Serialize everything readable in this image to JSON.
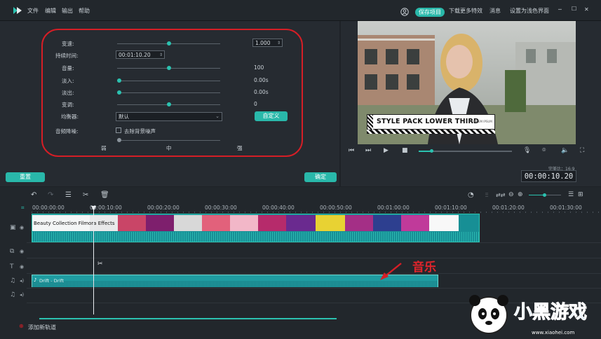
{
  "menu": {
    "file": "文件",
    "edit": "编辑",
    "export": "输出",
    "help": "帮助"
  },
  "topbar": {
    "save_project": "保存项目",
    "download_effects": "下载更多特效",
    "messages": "消息",
    "fullscreen": "设置为浅色界面",
    "minimize": "─",
    "maximize": "☐",
    "close": "✕"
  },
  "audio": {
    "speed_label": "变速:",
    "speed_value": "1.000",
    "duration_label": "持续时间:",
    "duration_value": "00:01:10.20",
    "volume_label": "音量:",
    "volume_value": "100",
    "fadein_label": "淡入:",
    "fadein_value": "0.00s",
    "fadeout_label": "淡出:",
    "fadeout_value": "0.00s",
    "pitch_label": "变调:",
    "pitch_value": "0",
    "eq_label": "均衡器:",
    "eq_value": "默认",
    "eq_custom": "自定义",
    "denoise_label": "音频降噪:",
    "denoise_option": "去除背景噪声",
    "weak": "弱",
    "medium": "中",
    "strong": "强",
    "sliders": {
      "speed": 0.5,
      "volume": 0.5,
      "fadein": 0,
      "fadeout": 0,
      "pitch": 0.5,
      "denoise": 0
    }
  },
  "buttons": {
    "reset": "重置",
    "ok": "确定"
  },
  "preview": {
    "lower_third": "STYLE PACK LOWER THIRD",
    "sub_text": "LOREM IPSUM",
    "quality_label": "完美比：",
    "quality_value": "16:9",
    "timecode": "00:00:10.20"
  },
  "timeline": {
    "ruler": [
      "00:00:00:00",
      "00:00:10:00",
      "00:00:20:00",
      "00:00:30:00",
      "00:00:40:00",
      "00:00:50:00",
      "00:01:00:00",
      "00:01:10:00",
      "00:01:20:00",
      "00:01:30:00"
    ],
    "video_clip": "Beauty Collection Filmora Effects",
    "audio_clip": "Drift - Drift",
    "add_track": "添加新轨道",
    "annotation": "音乐"
  },
  "watermark": {
    "brand": "小黑游戏",
    "url": "www.xiaohei.com"
  },
  "colors": {
    "accent": "#29b8aa",
    "frame": "#d51e26",
    "bg": "#1e2227",
    "panel": "#262b31",
    "audio_track": "#1f9ca1"
  }
}
